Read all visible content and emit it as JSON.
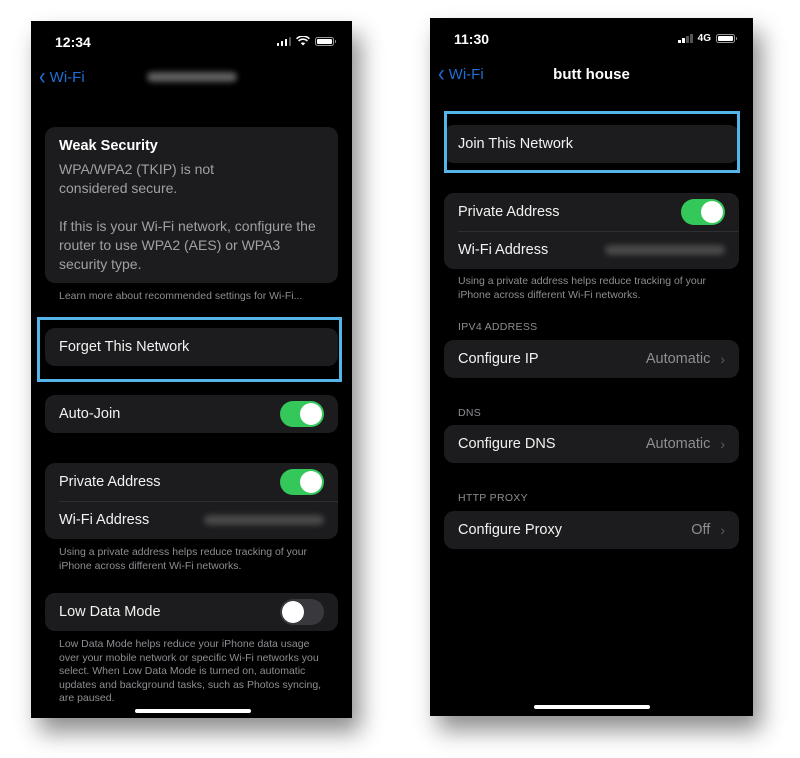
{
  "left_phone": {
    "status_bar": {
      "time": "12:34",
      "network_icon": "wifi-icon"
    },
    "nav": {
      "back_label": "Wi-Fi",
      "back_icon": "chevron-left-icon",
      "title": "[blurred network name]"
    },
    "weak_security": {
      "title": "Weak Security",
      "line1": "WPA/WPA2 (TKIP) is not considered secure.",
      "line2": "If this is your Wi-Fi network, configure the router to use WPA2 (AES) or WPA3 security type."
    },
    "learn_more_link": "Learn more about recommended settings for Wi-Fi...",
    "forget_button": "Forget This Network",
    "auto_join": {
      "label": "Auto-Join",
      "on": true
    },
    "private_address": {
      "label": "Private Address",
      "on": true
    },
    "wifi_address": {
      "label": "Wi-Fi Address",
      "value": "[blurred]"
    },
    "private_address_note": "Using a private address helps reduce tracking of your iPhone across different Wi-Fi networks.",
    "low_data_mode": {
      "label": "Low Data Mode",
      "on": false
    },
    "low_data_note": "Low Data Mode helps reduce your iPhone data usage over your mobile network or specific Wi-Fi networks you select. When Low Data Mode is turned on, automatic updates and background tasks, such as Photos syncing, are paused."
  },
  "right_phone": {
    "status_bar": {
      "time": "11:30",
      "network_label": "4G"
    },
    "nav": {
      "back_label": "Wi-Fi",
      "back_icon": "chevron-left-icon",
      "title": "butt house"
    },
    "join_button": "Join This Network",
    "private_address": {
      "label": "Private Address",
      "on": true
    },
    "wifi_address": {
      "label": "Wi-Fi Address",
      "value": "[blurred]"
    },
    "private_address_note": "Using a private address helps reduce tracking of your iPhone across different Wi-Fi networks.",
    "ipv4": {
      "header": "IPV4 ADDRESS",
      "label": "Configure IP",
      "value": "Automatic"
    },
    "dns": {
      "header": "DNS",
      "label": "Configure DNS",
      "value": "Automatic"
    },
    "proxy": {
      "header": "HTTP PROXY",
      "label": "Configure Proxy",
      "value": "Off"
    },
    "chevron_glyph": "›"
  },
  "colors": {
    "ios_blue": "#1f6fd6",
    "toggle_green": "#34c759",
    "highlight_border": "#56b5e8",
    "cell_bg": "#1c1c1e"
  }
}
